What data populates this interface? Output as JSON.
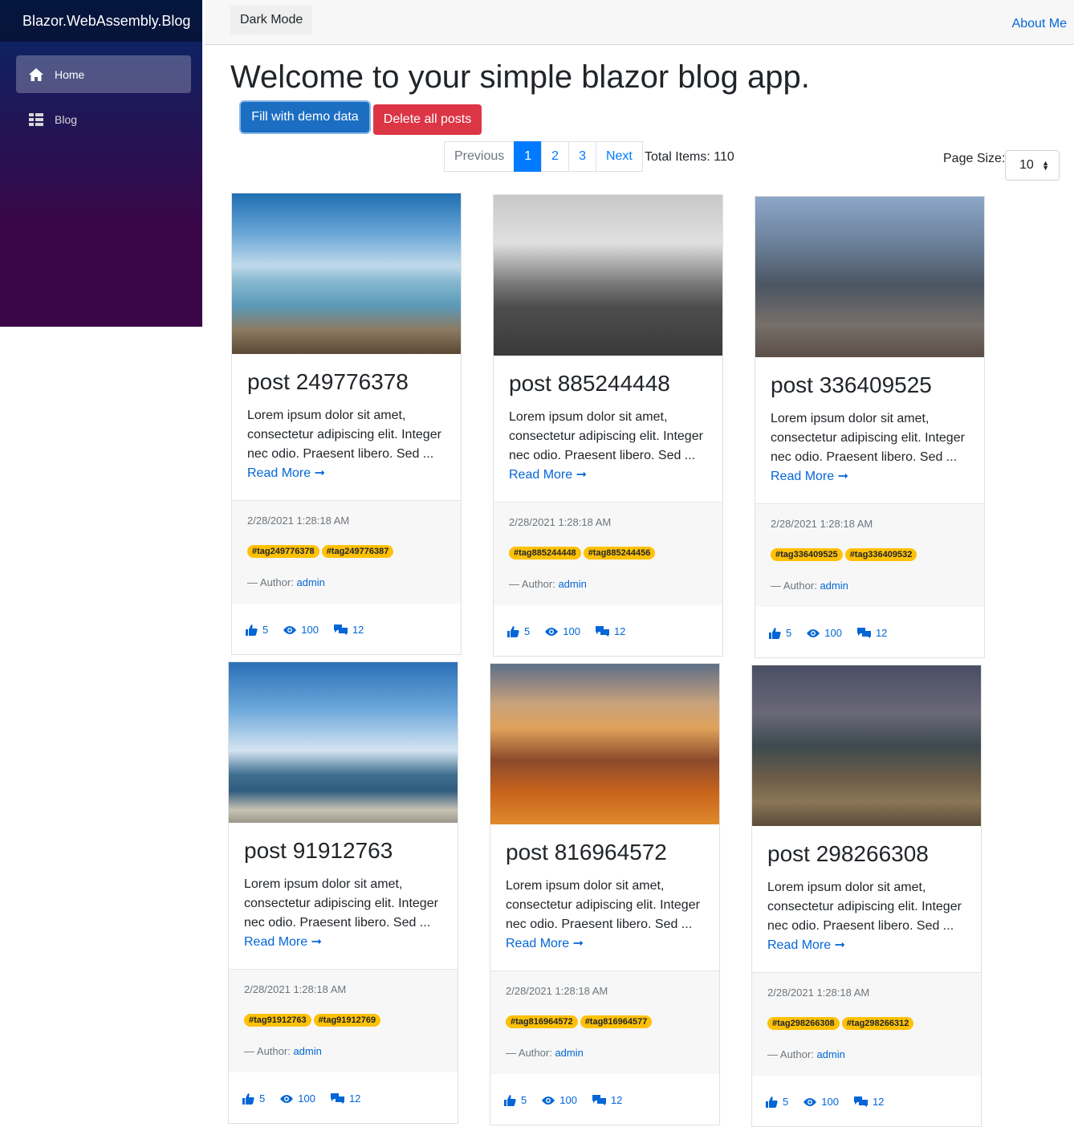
{
  "app": {
    "brand": "Blazor.WebAssembly.Blog"
  },
  "sidebar": {
    "items": [
      {
        "label": "Home",
        "icon": "home-icon"
      },
      {
        "label": "Blog",
        "icon": "list-icon"
      }
    ]
  },
  "topbar": {
    "dark_mode_label": "Dark Mode",
    "about_label": "About Me"
  },
  "main": {
    "title": "Welcome to your simple blazor blog app.",
    "fill_demo_label": "Fill with demo data",
    "delete_all_label": "Delete all posts"
  },
  "pager": {
    "previous": "Previous",
    "pages": [
      "1",
      "2",
      "3"
    ],
    "next": "Next",
    "current": "1",
    "total_label": "Total Items:",
    "total": "110",
    "page_size_label": "Page Size:",
    "page_size": "10"
  },
  "card_common": {
    "excerpt": "Lorem ipsum dolor sit amet, consectetur adipiscing elit. Integer nec odio. Praesent libero. Sed ...",
    "read_more": "Read More",
    "date": "2/28/2021 1:28:18 AM",
    "author_label": "Author:",
    "author": "admin",
    "likes": "5",
    "views": "100",
    "comments": "12"
  },
  "posts": [
    {
      "title": "post 249776378",
      "tags": [
        "#tag249776378",
        "#tag249776387"
      ],
      "image": "pier"
    },
    {
      "title": "post 885244448",
      "tags": [
        "#tag885244448",
        "#tag885244456"
      ],
      "image": "coast"
    },
    {
      "title": "post 336409525",
      "tags": [
        "#tag336409525",
        "#tag336409532"
      ],
      "image": "city"
    },
    {
      "title": "post 91912763",
      "tags": [
        "#tag91912763",
        "#tag91912769"
      ],
      "image": "beach"
    },
    {
      "title": "post 816964572",
      "tags": [
        "#tag816964572",
        "#tag816964577"
      ],
      "image": "sunset"
    },
    {
      "title": "post 298266308",
      "tags": [
        "#tag298266308",
        "#tag298266312"
      ],
      "image": "railway"
    }
  ],
  "colors": {
    "accent": "#1b6ec2",
    "danger": "#dc3545",
    "link": "#0366d6",
    "tag": "#ffc107"
  }
}
